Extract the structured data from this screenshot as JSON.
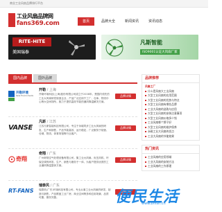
{
  "topbar": {
    "text": "商业工业风扇品牌排行平台"
  },
  "logo": {
    "line1": "工业风扇品牌网",
    "line2": "fans369.com"
  },
  "nav": [
    {
      "label": "首页",
      "active": true
    },
    {
      "label": "品牌大全",
      "active": false
    },
    {
      "label": "新闻资讯",
      "active": false
    },
    {
      "label": "资讯动态",
      "active": false
    }
  ],
  "banners": [
    {
      "brand": "RITE-HITE",
      "subtitle": "美国瑞泰"
    },
    {
      "title": "凡斯智能",
      "subtitle": "ISO9001认证大风扇厂家"
    }
  ],
  "tabs": [
    {
      "label": "国内品牌",
      "active": true
    },
    {
      "label": "国外品牌",
      "active": false
    }
  ],
  "brands": [
    {
      "name": "开勒",
      "region": "上海",
      "logo_text": "开勒环境",
      "logo_sub": "Kaile Environments",
      "desc": "开勒环境科技(上海)股份有限公司成立于2008年，是国内领先的工业大风扇研发制造企业，产品广泛应用于工厂、仓库、物流中心等大空间场所，致力于提供高效节能的通风降温解决方案。",
      "button": "品牌详情"
    },
    {
      "name": "凡斯",
      "region": "江苏",
      "logo_text": "VANSE",
      "logo_sub": "",
      "desc": "江苏凡斯智能科技有限公司，专注于永磁同步工业大风扇的研发、生产和销售，产品节能高效、运行稳定，广泛服务于制造、仓储、物流、体育场馆等行业客户。",
      "button": "品牌详情"
    },
    {
      "name": "奇翔",
      "region": "广东",
      "logo_text": "奇翔",
      "logo_sub": "",
      "desc": "广州奇翔空气处理设备有限公司，集工业大风扇、负压风机、环保空调的研发、生产、销售与服务于一体，为客户提供优质的工业通风降温整体方案。",
      "button": "品牌详情"
    },
    {
      "name": "瑞泰风",
      "region": "广东",
      "logo_text": "RT-FANS",
      "logo_sub": "",
      "desc": "瑞泰风(广东)环境科技有限公司，专业从事工业大风扇的研发、制造与销售，产品覆盖工业厂房、商业空间等多种应用场景，品质可靠，服务完善。",
      "button": "品牌详情"
    }
  ],
  "sidebar": {
    "panel1": {
      "title": "品牌推荐",
      "items": [
        "风扇工厂",
        "什么是风扇大工业风扇",
        "大型工业风扇的应用范围",
        "大型工业风扇的优势与特点",
        "大型工业风扇有哪些品牌",
        "工业大风扇的选购与应用",
        "大型工业风扇的安装注意事项",
        "大型工业风扇价格多少钱",
        "工业风扇哪个牌子好",
        "大型工业风扇的维护保养",
        "永磁工业大风扇的优点",
        "工业大风扇的节能效果"
      ]
    },
    "panel2": {
      "title": "热门资讯",
      "items": [
        "工业风扇的应用领域",
        "工业大风扇的安装方法",
        "工业风扇的工作原理",
        "工业大风扇哪家好",
        "永磁工业大风扇厂家"
      ]
    }
  },
  "watermark": {
    "text": "便民生活",
    "url": "www.bmsh.cn"
  },
  "colors": {
    "accent": "#d32f2f",
    "watermark": "#1e88e5"
  }
}
